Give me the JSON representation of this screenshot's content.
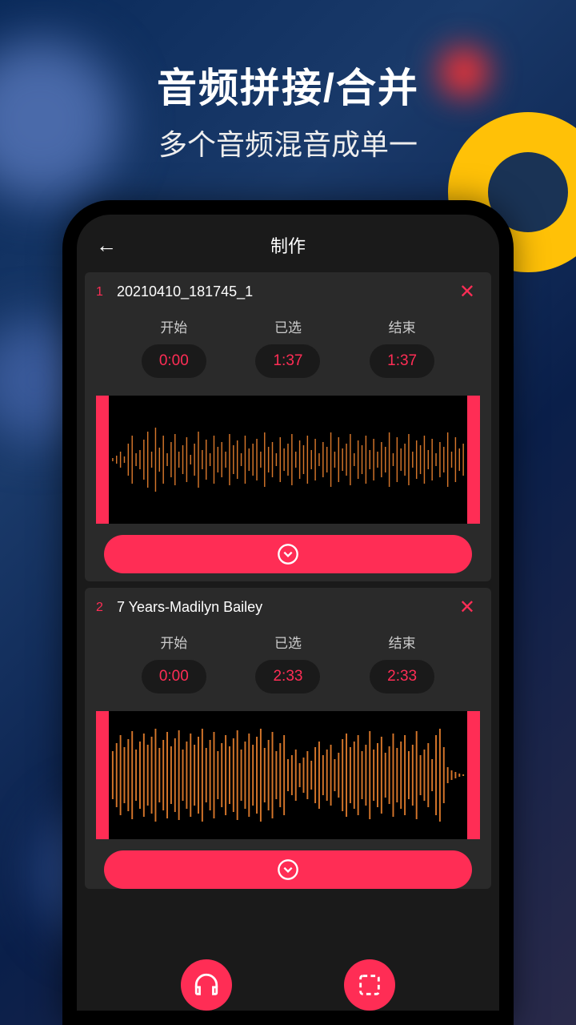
{
  "title": {
    "main": "音频拼接/合并",
    "sub": "多个音频混音成单一"
  },
  "header": {
    "title": "制作",
    "back_icon": "←"
  },
  "labels": {
    "start": "开始",
    "selected": "已选",
    "end": "结束",
    "close": "✕"
  },
  "tracks": [
    {
      "index": "1",
      "name": "20210410_181745_1",
      "start": "0:00",
      "selected": "1:37",
      "end": "1:37"
    },
    {
      "index": "2",
      "name": "7 Years-Madilyn Bailey",
      "start": "0:00",
      "selected": "2:33",
      "end": "2:33"
    }
  ],
  "colors": {
    "accent": "#ff2d55",
    "ring": "#ffc107"
  }
}
